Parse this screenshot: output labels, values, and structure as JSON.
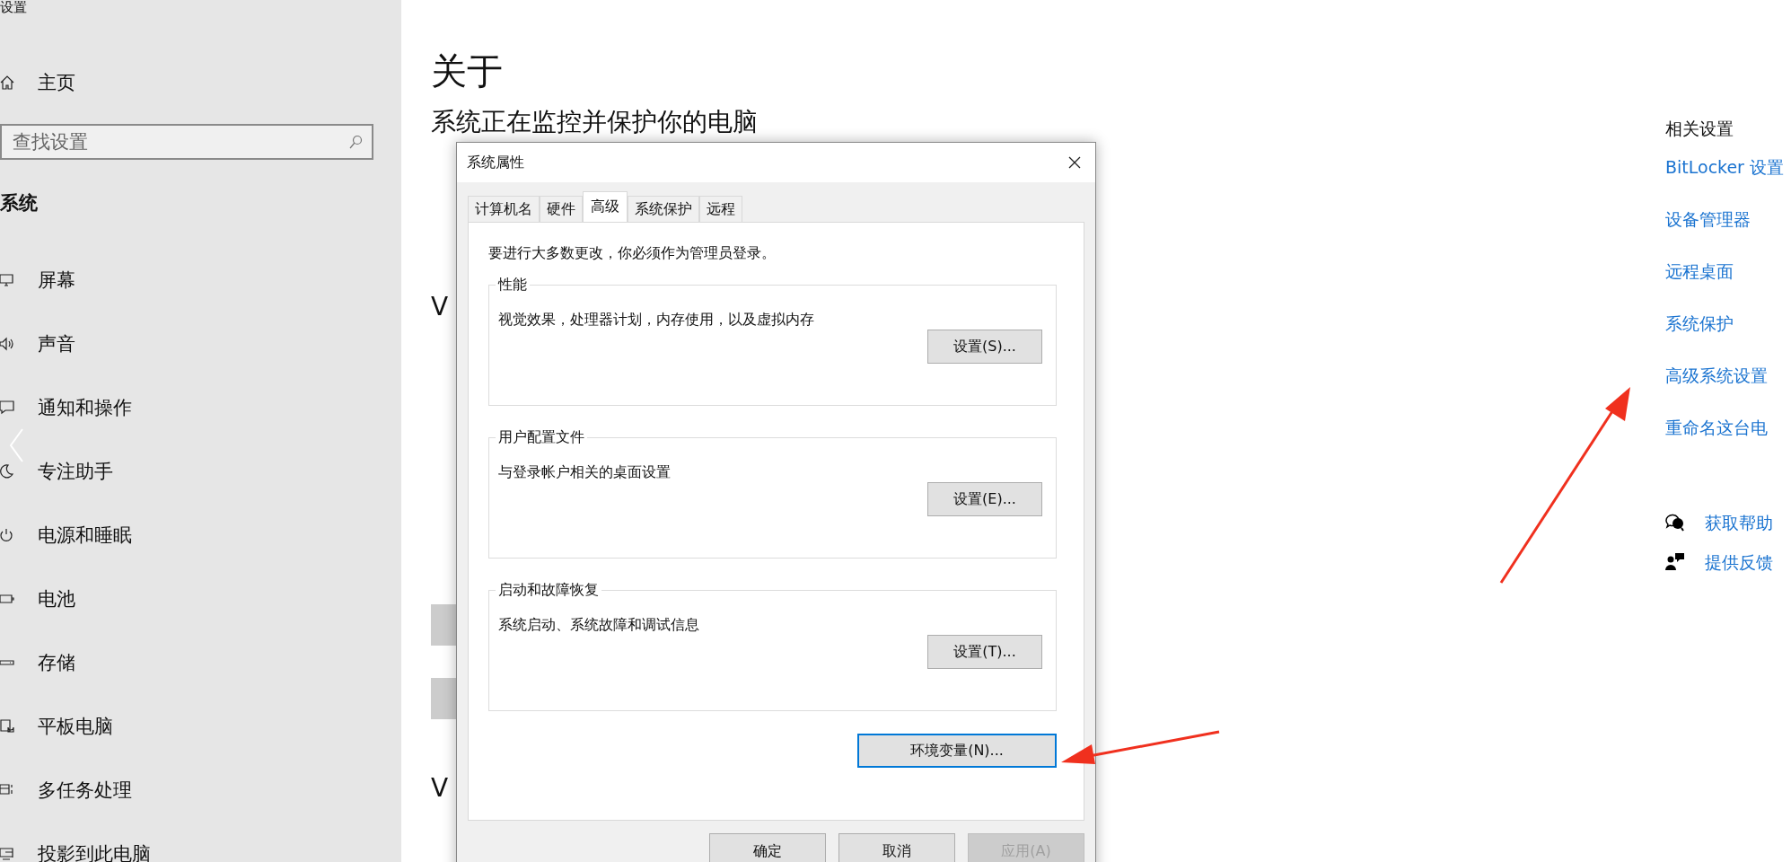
{
  "window": {
    "title": "设置"
  },
  "sidebar": {
    "home": "主页",
    "search": {
      "placeholder": "查找设置"
    },
    "section": "系统",
    "items": [
      {
        "label": "屏幕"
      },
      {
        "label": "声音"
      },
      {
        "label": "通知和操作"
      },
      {
        "label": "专注助手"
      },
      {
        "label": "电源和睡眠"
      },
      {
        "label": "电池"
      },
      {
        "label": "存储"
      },
      {
        "label": "平板电脑"
      },
      {
        "label": "多任务处理"
      },
      {
        "label": "投影到此电脑"
      }
    ]
  },
  "page": {
    "title": "关于",
    "subtitle": "系统正在监控并保护你的电脑",
    "fragments": [
      "V",
      "V"
    ]
  },
  "related": {
    "heading": "相关设置",
    "links": [
      "BitLocker 设置",
      "设备管理器",
      "远程桌面",
      "系统保护",
      "高级系统设置",
      "重命名这台电"
    ],
    "help": [
      "获取帮助",
      "提供反馈"
    ]
  },
  "dialog": {
    "title": "系统属性",
    "tabs": [
      {
        "label": "计算机名",
        "selected": false
      },
      {
        "label": "硬件",
        "selected": false
      },
      {
        "label": "高级",
        "selected": true
      },
      {
        "label": "系统保护",
        "selected": false
      },
      {
        "label": "远程",
        "selected": false
      }
    ],
    "note": "要进行大多数更改，你必须作为管理员登录。",
    "groups": [
      {
        "title": "性能",
        "text": "视觉效果，处理器计划，内存使用，以及虚拟内存",
        "button": "设置(S)..."
      },
      {
        "title": "用户配置文件",
        "text": "与登录帐户相关的桌面设置",
        "button": "设置(E)..."
      },
      {
        "title": "启动和故障恢复",
        "text": "系统启动、系统故障和调试信息",
        "button": "设置(T)..."
      }
    ],
    "env_button": {
      "label": "环境变量(N)...",
      "focused": true
    },
    "buttons": [
      {
        "label": "确定",
        "disabled": false
      },
      {
        "label": "取消",
        "disabled": false
      },
      {
        "label": "应用(A)",
        "disabled": true
      }
    ]
  }
}
